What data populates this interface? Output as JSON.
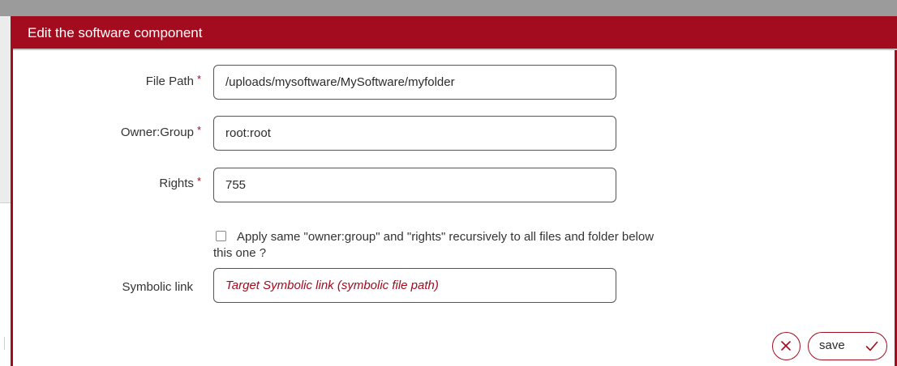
{
  "dialog": {
    "title": "Edit the software component"
  },
  "form": {
    "file_path": {
      "label": "File Path",
      "required_mark": "*",
      "value": "/uploads/mysoftware/MySoftware/myfolder"
    },
    "owner_group": {
      "label": "Owner:Group",
      "required_mark": "*",
      "value": "root:root"
    },
    "rights": {
      "label": "Rights",
      "required_mark": "*",
      "value": "755"
    },
    "recursive_checkbox": {
      "checked": false,
      "label": "Apply same \"owner:group\" and \"rights\" recursively to all files and folder below this one ?"
    },
    "symbolic_link": {
      "label": "Symbolic link",
      "value": "",
      "placeholder": "Target Symbolic link (symbolic file path)"
    }
  },
  "footer": {
    "cancel_icon": "close-icon",
    "save_label": "save",
    "save_icon": "check-icon"
  },
  "colors": {
    "accent": "#a30b1f",
    "header_text": "#ffffff",
    "background_bar": "#9b9b9b"
  }
}
